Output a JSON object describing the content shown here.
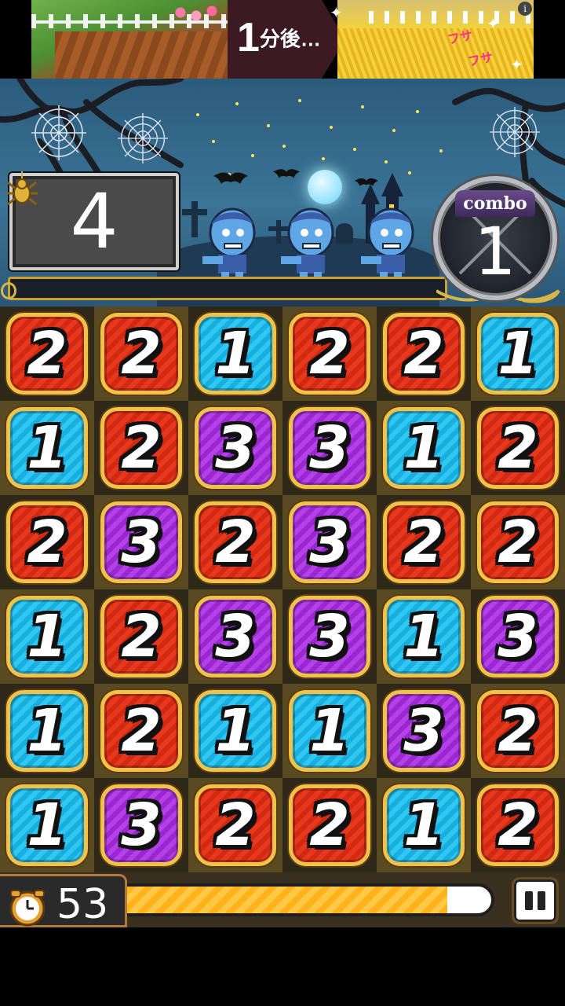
{
  "ad": {
    "headline_num": "1",
    "headline_rest": "分後…",
    "fusa_1": "フサ",
    "fusa_2": "フサ",
    "info_icon": "i"
  },
  "stats": {
    "remaining_count": "4",
    "combo_label": "combo",
    "combo_value": "1",
    "stage_progress": 0
  },
  "board": {
    "columns": 6,
    "rows": [
      [
        "2",
        "2",
        "1",
        "2",
        "2",
        "1"
      ],
      [
        "1",
        "2",
        "3",
        "3",
        "1",
        "2"
      ],
      [
        "2",
        "3",
        "2",
        "3",
        "2",
        "2"
      ],
      [
        "1",
        "2",
        "3",
        "3",
        "1",
        "3"
      ],
      [
        "1",
        "2",
        "1",
        "1",
        "3",
        "2"
      ],
      [
        "1",
        "3",
        "2",
        "2",
        "1",
        "2"
      ]
    ],
    "tile_colors": {
      "1": "#1aaee0",
      "2": "#d22a12",
      "3": "#9a28d2"
    }
  },
  "timer": {
    "seconds": "53",
    "fill_fraction": 0.88,
    "icon": "clock-icon"
  },
  "controls": {
    "pause_icon": "pause-icon"
  },
  "colors": {
    "sky": "#3a7496",
    "tile_border": "#f0c24a",
    "timer_fill": "#ffb21a"
  }
}
